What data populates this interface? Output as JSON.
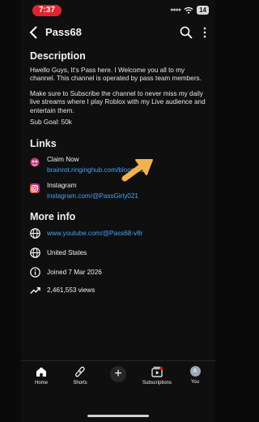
{
  "status_bar": {
    "time": "7:37",
    "battery": "14"
  },
  "header": {
    "channel_name": "Pass68"
  },
  "description": {
    "heading": "Description",
    "paragraph1": "Hwello Guys, It's Pass here. I Welcome you all to my channel. This channel is operated by pass team members.",
    "paragraph2": "Make sure to Subscribe the channel to never miss my daily live streams where I play Roblox with my Live audience and entertain them.",
    "sub_goal": "Sub Goal: 50k"
  },
  "links": {
    "heading": "Links",
    "items": [
      {
        "title": "Claim Now",
        "url": "brainrot.ringinghub.com/bloombux",
        "icon": "globe-brainrot-icon"
      },
      {
        "title": "Instagram",
        "url": "instagram.com/@PassGirly021",
        "icon": "instagram-icon"
      }
    ]
  },
  "more_info": {
    "heading": "More info",
    "items": [
      {
        "text": "www.youtube.com/@Pass68-v8r",
        "icon": "globe-icon"
      },
      {
        "text": "United States",
        "icon": "globe-icon"
      },
      {
        "text": "Joined 7 Mar 2026",
        "icon": "info-icon"
      },
      {
        "text": "2,461,553 views",
        "icon": "trending-icon"
      }
    ]
  },
  "bottom_nav": {
    "home": "Home",
    "shorts": "Shorts",
    "subscriptions": "Subscriptions",
    "you": "You",
    "avatar_letter": "A"
  },
  "colors": {
    "accent_link": "#3ea6ff",
    "time_pill": "#e0242e",
    "arrow": "#f2b34c"
  }
}
